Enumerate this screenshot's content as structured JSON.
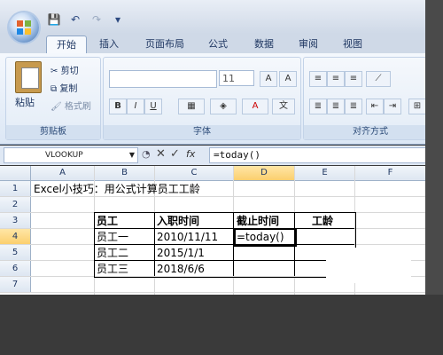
{
  "tabs": [
    "开始",
    "插入",
    "页面布局",
    "公式",
    "数据",
    "审阅",
    "视图"
  ],
  "ribbon": {
    "clipboard": {
      "paste": "粘贴",
      "cut": "剪切",
      "copy": "复制",
      "format_painter": "格式刷",
      "label": "剪贴板"
    },
    "font": {
      "font_name": "",
      "font_size": "11",
      "label": "字体",
      "bold": "B",
      "italic": "I",
      "underline": "U"
    },
    "alignment": {
      "label": "对齐方式"
    }
  },
  "formula_bar": {
    "name_box": "VLOOKUP",
    "fx_label": "fx",
    "formula": "=today()"
  },
  "sheet": {
    "columns": [
      "A",
      "B",
      "C",
      "D",
      "E",
      "F"
    ],
    "rows": [
      "1",
      "2",
      "3",
      "4",
      "5",
      "6",
      "7"
    ],
    "title": "Excel小技巧：用公式计算员工工龄",
    "headers": [
      "员工",
      "入职时间",
      "截止时间",
      "工龄"
    ],
    "data": [
      [
        "员工一",
        "2010/11/11",
        "=today()",
        ""
      ],
      [
        "员工二",
        "2015/1/1",
        "",
        ""
      ],
      [
        "员工三",
        "2018/6/6",
        "",
        ""
      ]
    ]
  }
}
